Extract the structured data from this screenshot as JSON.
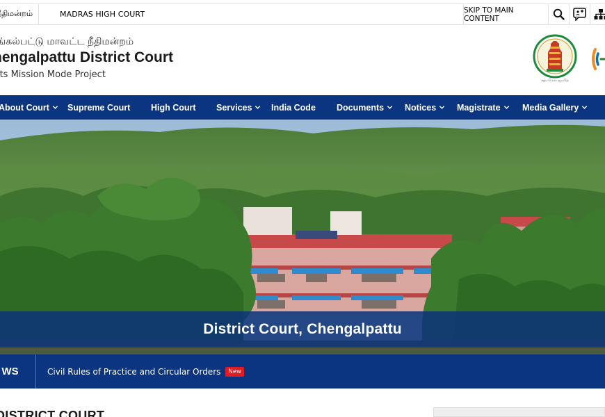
{
  "topbar": {
    "tamil_link": "ர் நீதிமன்றம்",
    "high_court_link": "MADRAS HIGH COURT",
    "skip_link": "SKIP TO MAIN CONTENT",
    "icons": [
      "search-icon",
      "sign-language-icon",
      "sitemap-icon"
    ]
  },
  "header": {
    "tamil_title": "ங்கல்பட்டு மாவட்ட நீதிமன்றம்",
    "court_title": "hengalpattu District Court",
    "subtitle": "urts Mission Mode Project",
    "emblem_text": "சத்யமேவ ஜயதே"
  },
  "nav": {
    "items": [
      {
        "label": "About Court",
        "dropdown": true
      },
      {
        "label": "Supreme Court",
        "dropdown": false
      },
      {
        "label": "High Court",
        "dropdown": false
      },
      {
        "label": "Services",
        "dropdown": true
      },
      {
        "label": "India Code",
        "dropdown": false
      },
      {
        "label": "Documents",
        "dropdown": true
      },
      {
        "label": "Notices",
        "dropdown": true
      },
      {
        "label": "Magistrate",
        "dropdown": true
      },
      {
        "label": "Media Gallery",
        "dropdown": true
      }
    ]
  },
  "hero": {
    "caption": "District Court, Chengalpattu"
  },
  "news": {
    "label": "WS",
    "headline": "Civil Rules of Practice and Circular Orders",
    "badge": "New"
  },
  "section": {
    "heading": "DISTRICT COURT"
  },
  "colors": {
    "nav_bg": "#0b3580",
    "badge": "#e21b22",
    "caption_bg": "#0e3478"
  }
}
